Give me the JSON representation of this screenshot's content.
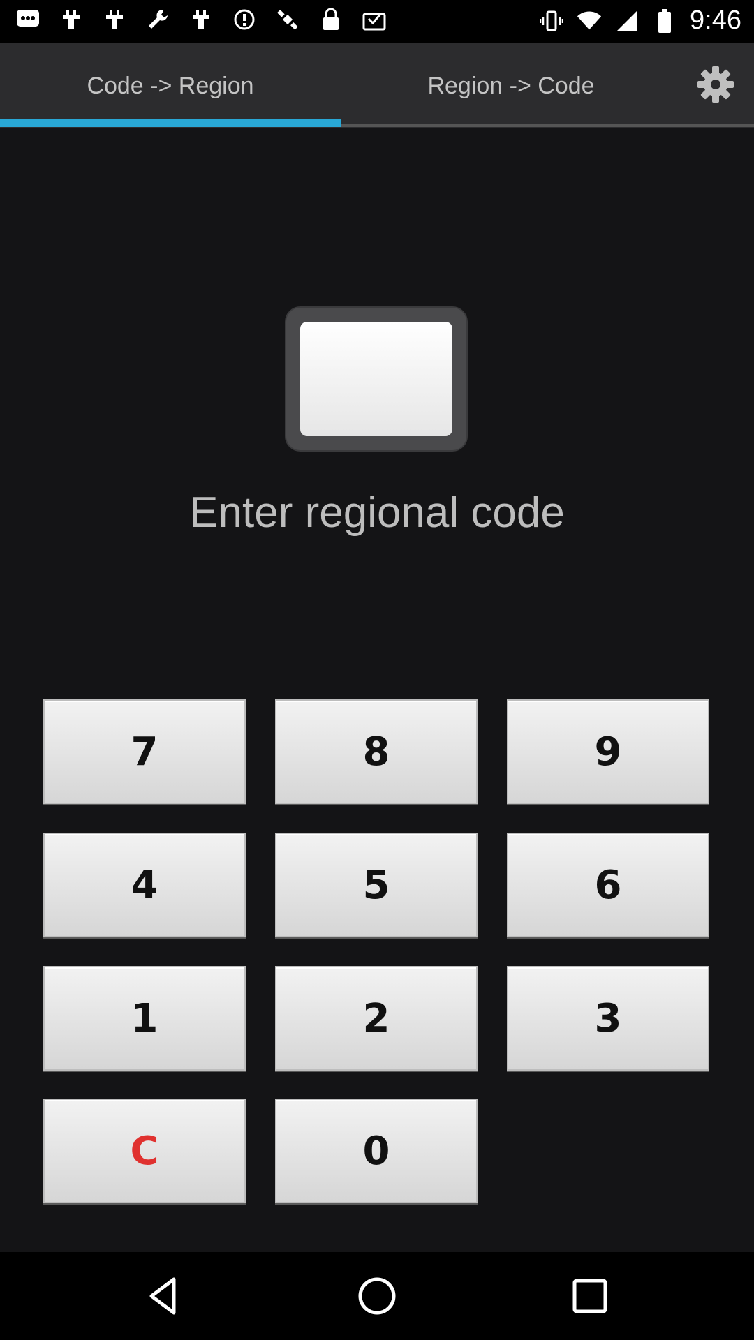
{
  "status_bar": {
    "time": "9:46",
    "left_icons": [
      "messages-icon",
      "hashtag-icon",
      "hashtag-icon",
      "wrench-icon",
      "hashtag-icon",
      "circle-info-icon",
      "satellite-icon",
      "lock-icon",
      "checkbox-icon"
    ],
    "right_icons": [
      "vibrate-icon",
      "wifi-icon",
      "signal-icon",
      "battery-icon"
    ]
  },
  "tabs": [
    {
      "label": "Code -> Region",
      "active": true
    },
    {
      "label": "Region -> Code",
      "active": false
    }
  ],
  "settings": {
    "icon": "gear-icon"
  },
  "display": {
    "value": ""
  },
  "prompt": "Enter regional code",
  "keypad": {
    "rows": [
      [
        "7",
        "8",
        "9"
      ],
      [
        "4",
        "5",
        "6"
      ],
      [
        "1",
        "2",
        "3"
      ],
      [
        "C",
        "0"
      ]
    ]
  },
  "colors": {
    "accent": "#29a8d6",
    "tab_bar": "#2c2c2e",
    "background": "#141416",
    "clear_key": "#e0312f"
  },
  "nav_bar": {
    "icons": [
      "back-icon",
      "home-icon",
      "recents-icon"
    ]
  }
}
